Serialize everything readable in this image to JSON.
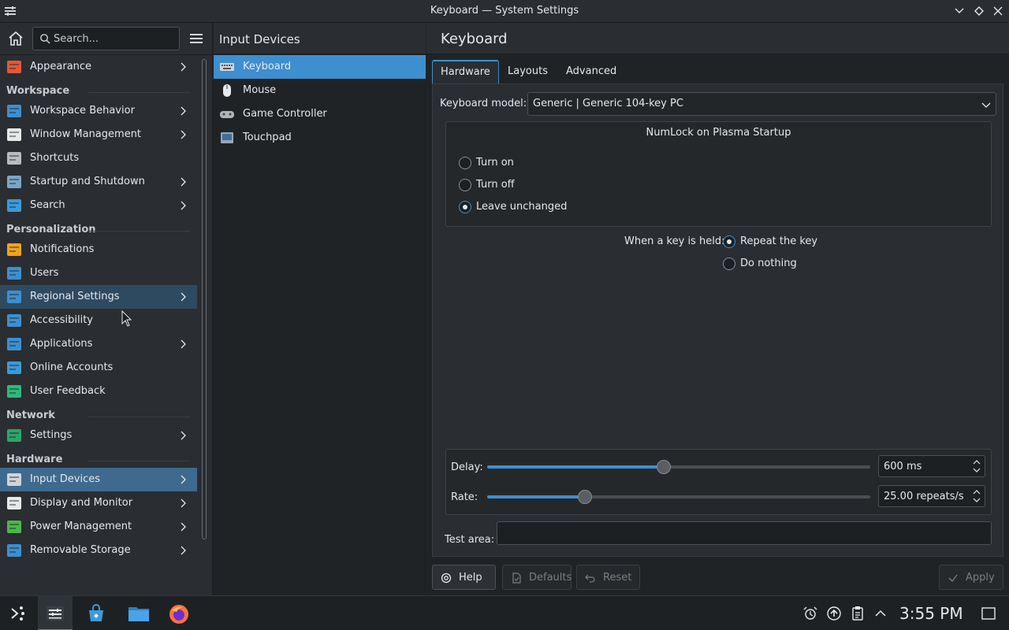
{
  "window": {
    "title": "Keyboard — System Settings"
  },
  "sidebar": {
    "search_placeholder": "Search...",
    "items": [
      {
        "type": "item",
        "label": "Appearance",
        "icon": "appearance-icon",
        "color": "#e05a3a",
        "chevron": true
      },
      {
        "type": "header",
        "label": "Workspace"
      },
      {
        "type": "item",
        "label": "Workspace Behavior",
        "icon": "workspace-behavior-icon",
        "color": "#3d8fd0",
        "chevron": true
      },
      {
        "type": "item",
        "label": "Window Management",
        "icon": "window-management-icon",
        "color": "#e6e8ea",
        "chevron": true
      },
      {
        "type": "item",
        "label": "Shortcuts",
        "icon": "shortcuts-icon",
        "color": "#b8bcc0",
        "chevron": false
      },
      {
        "type": "item",
        "label": "Startup and Shutdown",
        "icon": "startup-shutdown-icon",
        "color": "#7aa6c8",
        "chevron": true
      },
      {
        "type": "item",
        "label": "Search",
        "icon": "search-settings-icon",
        "color": "#3d9ad8",
        "chevron": true
      },
      {
        "type": "header",
        "label": "Personalization"
      },
      {
        "type": "item",
        "label": "Notifications",
        "icon": "notifications-icon",
        "color": "#f2a21d",
        "chevron": false
      },
      {
        "type": "item",
        "label": "Users",
        "icon": "users-icon",
        "color": "#3d8fd0",
        "chevron": false
      },
      {
        "type": "item",
        "label": "Regional Settings",
        "icon": "regional-settings-icon",
        "color": "#3d8fd0",
        "chevron": true,
        "state": "hover"
      },
      {
        "type": "item",
        "label": "Accessibility",
        "icon": "accessibility-icon",
        "color": "#3d8fd0",
        "chevron": false
      },
      {
        "type": "item",
        "label": "Applications",
        "icon": "applications-icon",
        "color": "#3d8fd0",
        "chevron": true
      },
      {
        "type": "item",
        "label": "Online Accounts",
        "icon": "online-accounts-icon",
        "color": "#3d9ad8",
        "chevron": false
      },
      {
        "type": "item",
        "label": "User Feedback",
        "icon": "user-feedback-icon",
        "color": "#2fb87a",
        "chevron": false
      },
      {
        "type": "header",
        "label": "Network"
      },
      {
        "type": "item",
        "label": "Settings",
        "icon": "network-settings-icon",
        "color": "#2fa36b",
        "chevron": true
      },
      {
        "type": "header",
        "label": "Hardware"
      },
      {
        "type": "item",
        "label": "Input Devices",
        "icon": "input-devices-icon",
        "color": "#d0d4d8",
        "chevron": true,
        "state": "active"
      },
      {
        "type": "item",
        "label": "Display and Monitor",
        "icon": "display-monitor-icon",
        "color": "#e6e8ea",
        "chevron": true
      },
      {
        "type": "item",
        "label": "Power Management",
        "icon": "power-management-icon",
        "color": "#4cb848",
        "chevron": true
      },
      {
        "type": "item",
        "label": "Removable Storage",
        "icon": "removable-storage-icon",
        "color": "#3d8fd0",
        "chevron": true
      }
    ]
  },
  "middle": {
    "title": "Input Devices",
    "items": [
      {
        "label": "Keyboard",
        "icon": "keyboard-icon",
        "active": true
      },
      {
        "label": "Mouse",
        "icon": "mouse-icon",
        "active": false
      },
      {
        "label": "Game Controller",
        "icon": "game-controller-icon",
        "active": false
      },
      {
        "label": "Touchpad",
        "icon": "touchpad-icon",
        "active": false
      }
    ]
  },
  "content": {
    "title": "Keyboard",
    "tabs": [
      "Hardware",
      "Layouts",
      "Advanced"
    ],
    "keyboard_model_label": "Keyboard model:",
    "keyboard_model_value": "Generic | Generic 104-key PC",
    "numlock": {
      "title": "NumLock on Plasma Startup",
      "options": [
        "Turn on",
        "Turn off",
        "Leave unchanged"
      ],
      "selected": "Leave unchanged"
    },
    "key_held": {
      "label": "When a key is held:",
      "options": [
        "Repeat the key",
        "Do nothing"
      ],
      "selected": "Repeat the key"
    },
    "delay": {
      "label": "Delay:",
      "value_text": "600 ms",
      "fraction": 0.46
    },
    "rate": {
      "label": "Rate:",
      "value_text": "25.00 repeats/s",
      "fraction": 0.255
    },
    "test_area_label": "Test area:",
    "buttons": {
      "help": "Help",
      "defaults": "Defaults",
      "reset": "Reset",
      "apply": "Apply"
    }
  },
  "taskbar": {
    "clock": "3:55 PM"
  },
  "colors": {
    "accent": "#3d8fd0",
    "background": "#202326",
    "panel": "#2a2e32"
  }
}
